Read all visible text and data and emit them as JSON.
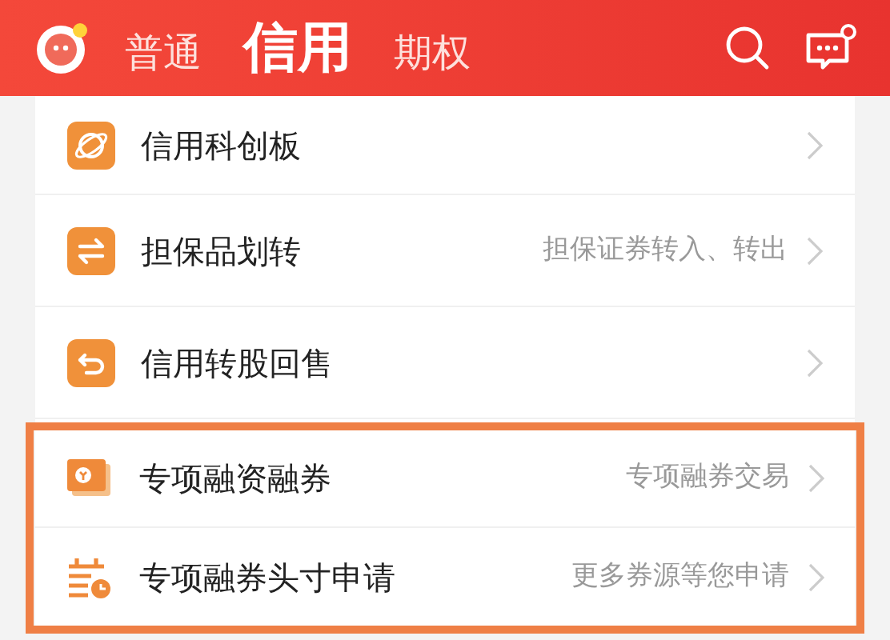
{
  "header": {
    "tabs": [
      {
        "label": "普通",
        "selected": false
      },
      {
        "label": "信用",
        "selected": true
      },
      {
        "label": "期权",
        "selected": false
      }
    ],
    "message_badge": true
  },
  "menu": {
    "items": [
      {
        "kind": "planet",
        "label": "信用科创板",
        "highlighted": false
      },
      {
        "kind": "swap",
        "label": "担保品划转",
        "hint": "担保证券转入、转出",
        "highlighted": false
      },
      {
        "kind": "return",
        "label": "信用转股回售",
        "highlighted": false
      },
      {
        "kind": "coupon",
        "label": "专项融资融券",
        "hint": "专项融券交易",
        "highlighted": true
      },
      {
        "kind": "calendar",
        "label": "专项融券头寸申请",
        "hint": "更多券源等您申请",
        "highlighted": true
      }
    ]
  }
}
